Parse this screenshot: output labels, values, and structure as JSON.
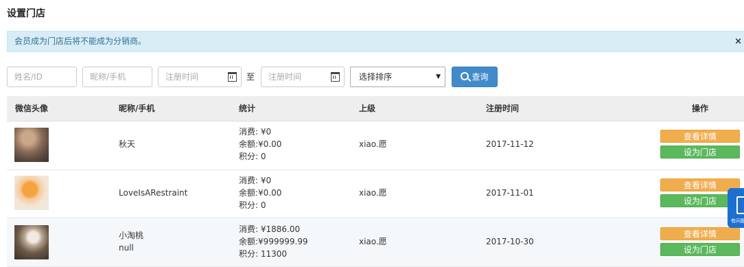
{
  "page": {
    "title": "设置门店"
  },
  "alert": {
    "text": "会员成为门店后将不能成为分销商。",
    "close": "×"
  },
  "filters": {
    "name_placeholder": "姓名/ID",
    "nick_placeholder": "昵称/手机",
    "date_from_placeholder": "注册时间",
    "to_label": "至",
    "date_to_placeholder": "注册时间",
    "sort_selected": "选择排序",
    "search_label": "查询"
  },
  "table": {
    "headers": {
      "avatar": "微信头像",
      "nick": "昵称/手机",
      "stats": "统计",
      "parent": "上级",
      "reg_time": "注册时间",
      "ops": "操作"
    },
    "rows": [
      {
        "nick": "秋天",
        "phone": "",
        "spend": "消费: ¥0",
        "balance": "余额:¥0.00",
        "points": "积分: 0",
        "parent": "xiao.愿",
        "reg_time": "2017-11-12",
        "detail_btn": "查看详情",
        "store_btn": "设为门店"
      },
      {
        "nick": "LoveIsARestraint",
        "phone": "",
        "spend": "消费: ¥0",
        "balance": "余额:¥0.00",
        "points": "积分: 0",
        "parent": "xiao.愿",
        "reg_time": "2017-11-01",
        "detail_btn": "查看详情",
        "store_btn": "设为门店"
      },
      {
        "nick": "小淘桃",
        "phone": "null",
        "spend": "消费: ¥1886.00",
        "balance": "余额:¥999999.99",
        "points": "积分: 11300",
        "parent": "xiao.愿",
        "reg_time": "2017-10-30",
        "detail_btn": "查看详情",
        "store_btn": "设为门店"
      }
    ]
  },
  "floating_widget": {
    "text": "有问题",
    "icon": "feedback-icon"
  },
  "colors": {
    "primary": "#428bca",
    "warning": "#f0ad4e",
    "success": "#5cb85c",
    "info_bg": "#d9edf7",
    "float_bg": "#1e6fd0"
  }
}
